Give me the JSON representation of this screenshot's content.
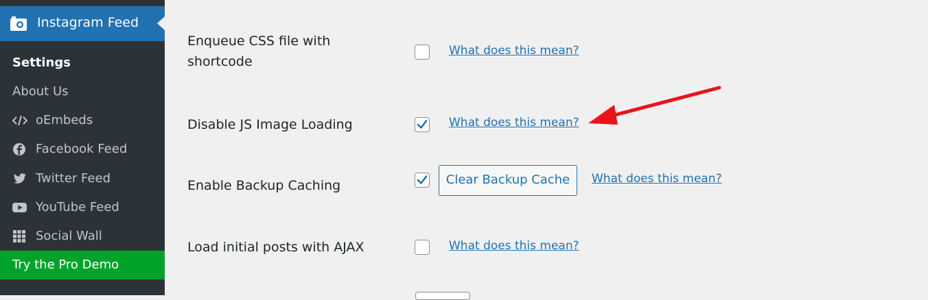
{
  "sidebar": {
    "menu_title": "Instagram Feed",
    "items": [
      {
        "label": "Settings",
        "icon": "none",
        "current": true
      },
      {
        "label": "About Us",
        "icon": "none"
      },
      {
        "label": "oEmbeds",
        "icon": "code-icon"
      },
      {
        "label": "Facebook Feed",
        "icon": "facebook-icon"
      },
      {
        "label": "Twitter Feed",
        "icon": "twitter-icon"
      },
      {
        "label": "YouTube Feed",
        "icon": "youtube-icon"
      },
      {
        "label": "Social Wall",
        "icon": "grid-icon"
      },
      {
        "label": "Try the Pro Demo",
        "icon": "none",
        "highlight": true
      }
    ],
    "colors": {
      "active": "#2271b1",
      "background": "#1d2327",
      "submenu": "#2c3338",
      "demo": "#00a32a"
    }
  },
  "settings": {
    "rows": [
      {
        "label_line1": "Enqueue CSS file with",
        "label_line2": "shortcode",
        "checked": false,
        "help": "What does this mean?"
      },
      {
        "label": "Disable JS Image Loading",
        "checked": true,
        "help": "What does this mean?"
      },
      {
        "label": "Enable Backup Caching",
        "checked": true,
        "button": "Clear Backup Cache",
        "help": "What does this mean?"
      },
      {
        "label": "Load initial posts with AJAX",
        "checked": false,
        "help": "What does this mean?"
      }
    ]
  },
  "annotation": {
    "arrow_color": "#e8141a"
  }
}
